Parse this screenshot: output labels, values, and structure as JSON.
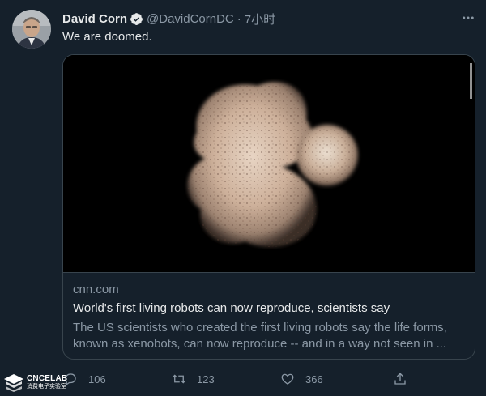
{
  "author": {
    "name": "David Corn",
    "handle": "@DavidCornDC",
    "separator": "·",
    "time": "7小时",
    "verified": true
  },
  "tweet": {
    "text": "We are doomed."
  },
  "card": {
    "image_subject": "xenobots-microscope-image",
    "domain": "cnn.com",
    "title": "World's first living robots can now reproduce, scientists say",
    "description": "The US scientists who created the first living robots say the life forms, known as xenobots, can now reproduce -- and in a way not seen in ..."
  },
  "actions": {
    "reply_count": "106",
    "retweet_count": "123",
    "like_count": "366"
  },
  "watermark": {
    "text": "CNCELAB",
    "subtext": "消费电子实验室"
  },
  "icons": [
    "more-icon",
    "verified-icon",
    "reply-icon",
    "retweet-icon",
    "like-icon",
    "share-icon"
  ],
  "colors": {
    "background": "#15202b",
    "primary_text": "#e7e9ea",
    "secondary_text": "#8b98a5",
    "border": "#38444d",
    "verified_badge": "#1d9bf0"
  }
}
